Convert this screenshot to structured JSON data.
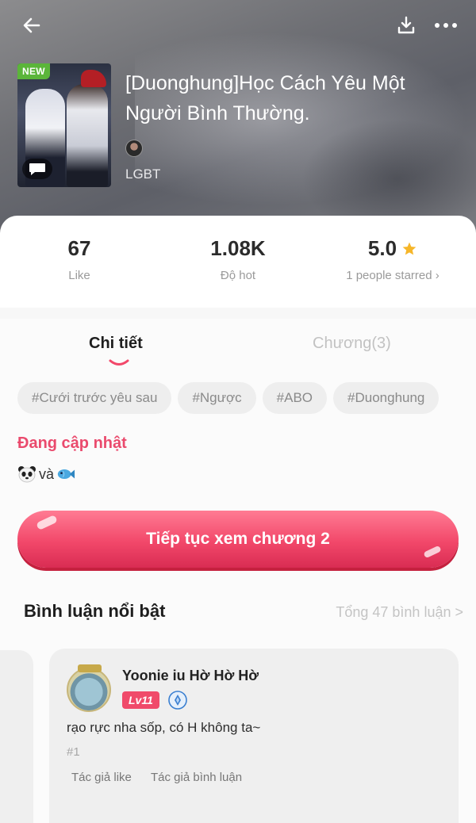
{
  "header": {
    "title": "[Duonghung]Học Cách Yêu Một Người Bình Thường.",
    "genre": "LGBT",
    "new_badge": "NEW"
  },
  "icons": {
    "back": "arrow-left-icon",
    "download": "download-icon",
    "more": "more-dots-icon",
    "chat": "chat-bubble-icon",
    "star": "star-icon"
  },
  "stats": {
    "likes": {
      "value": "67",
      "label": "Like"
    },
    "hot": {
      "value": "1.08K",
      "label": "Độ hot"
    },
    "rating": {
      "value": "5.0",
      "label": "1 people starred ›"
    }
  },
  "tabs": [
    {
      "label": "Chi tiết",
      "active": true
    },
    {
      "label": "Chương(3)",
      "active": false
    }
  ],
  "tags": [
    "#Cưới trước yêu sau",
    "#Ngược",
    "#ABO",
    "#Duonghung"
  ],
  "status": "Đang cập nhật",
  "description": {
    "text": "và"
  },
  "continue_button": "Tiếp tục xem chương 2",
  "comments": {
    "title": "Bình luận nổi bật",
    "total": "Tổng 47 bình luận >",
    "items": [
      {
        "username": "Yoonie iu Hờ Hờ Hờ",
        "level": "Lv11",
        "text": "rạo rực nha sốp, có H không ta~",
        "index": "#1",
        "meta_like": "Tác giả like",
        "meta_comment": "Tác giả bình luận"
      }
    ]
  },
  "colors": {
    "accent": "#f2486a",
    "status": "#ea4a6d",
    "star": "#f6b629"
  }
}
